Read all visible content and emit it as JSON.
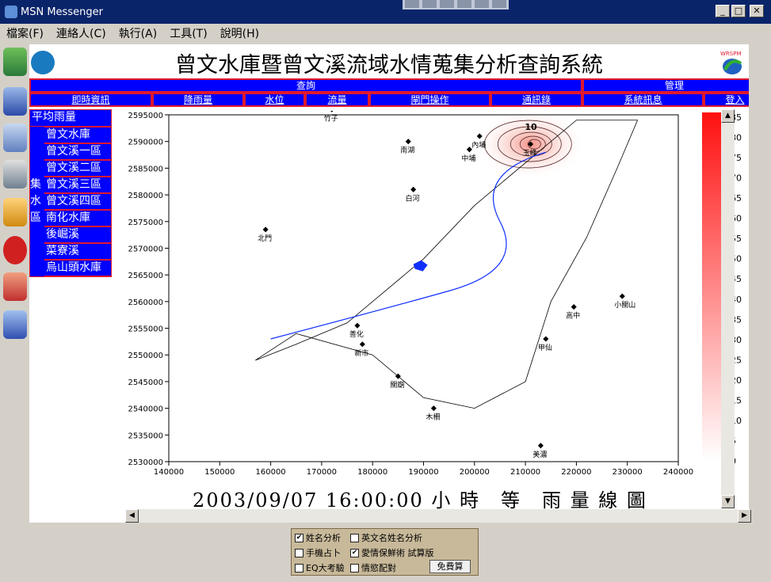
{
  "window": {
    "title": "MSN Messenger",
    "min_icon": "_",
    "max_icon": "□",
    "close_icon": "✕"
  },
  "menu": [
    "檔案(F)",
    "連絡人(C)",
    "執行(A)",
    "工具(T)",
    "說明(H)"
  ],
  "page": {
    "title": "曾文水庫暨曾文溪流域水情蒐集分析查詢系統",
    "right_logo_text": "WRSPM"
  },
  "nav": {
    "top": [
      "查詢",
      "管理"
    ],
    "sub": [
      "即時資訊",
      "降雨量",
      "水位",
      "流量",
      "閘門操作",
      "通訊錄",
      "系統訊息",
      "登入"
    ]
  },
  "left_menu": {
    "header": "平均雨量",
    "side_label": [
      "",
      "",
      "",
      "集",
      "水",
      "區",
      "",
      "",
      ""
    ],
    "items": [
      "曾文水庫",
      "曾文溪一區",
      "曾文溪二區",
      "曾文溪三區",
      "曾文溪四區",
      "南化水庫",
      "後崛溪",
      "菜寮溪",
      "烏山頭水庫"
    ]
  },
  "left_toolbar_icons": [
    "contact-icon",
    "windows-icon",
    "ncku-icon",
    "computer-icon",
    "bell-icon",
    "stamp-icon",
    "disaster-icon",
    "work-icon"
  ],
  "chart_data": {
    "type": "contour-map",
    "xlim": [
      140000,
      240000
    ],
    "ylim": [
      2530000,
      2595000
    ],
    "xticks": [
      140000,
      150000,
      160000,
      170000,
      180000,
      190000,
      200000,
      210000,
      220000,
      230000,
      240000
    ],
    "yticks": [
      2530000,
      2535000,
      2540000,
      2545000,
      2550000,
      2555000,
      2560000,
      2565000,
      2570000,
      2575000,
      2580000,
      2585000,
      2590000,
      2595000
    ],
    "colorbar": [
      85,
      80,
      75,
      70,
      65,
      60,
      55,
      50,
      45,
      40,
      35,
      30,
      25,
      20,
      15,
      10,
      5,
      0
    ],
    "contour_label": "10",
    "stations": [
      {
        "name": "玉峰",
        "x": 211000,
        "y": 2589500
      },
      {
        "name": "內埔",
        "x": 201000,
        "y": 2591000
      },
      {
        "name": "中埔",
        "x": 199000,
        "y": 2588500
      },
      {
        "name": "南湖",
        "x": 187000,
        "y": 2590000
      },
      {
        "name": "竹子",
        "x": 172000,
        "y": 2596000
      },
      {
        "name": "白河",
        "x": 188000,
        "y": 2581000
      },
      {
        "name": "北門",
        "x": 159000,
        "y": 2573500
      },
      {
        "name": "善化",
        "x": 177000,
        "y": 2555500
      },
      {
        "name": "新市",
        "x": 178000,
        "y": 2552000
      },
      {
        "name": "關廟",
        "x": 185000,
        "y": 2546000
      },
      {
        "name": "木柵",
        "x": 192000,
        "y": 2540000
      },
      {
        "name": "美濃",
        "x": 213000,
        "y": 2533000
      },
      {
        "name": "甲仙",
        "x": 214000,
        "y": 2553000
      },
      {
        "name": "高中",
        "x": 219500,
        "y": 2559000
      },
      {
        "name": "小關山",
        "x": 229000,
        "y": 2561000
      }
    ]
  },
  "caption": "2003/09/07 16:00:00 小 時　等　雨 量 線 圖",
  "footer": {
    "options": [
      {
        "label": "姓名分析",
        "checked": true
      },
      {
        "label": "英文名姓名分析",
        "checked": false
      },
      {
        "label": "手機占卜",
        "checked": false
      },
      {
        "label": "愛情保鮮術 試算版",
        "checked": true
      },
      {
        "label": "EQ大考驗",
        "checked": false
      },
      {
        "label": "情慾配對",
        "checked": false
      }
    ],
    "button": "免費算"
  },
  "colors": {
    "nav_bg": "#0000ff",
    "nav_border": "#e0182e",
    "title_bar": "#0a246a"
  }
}
